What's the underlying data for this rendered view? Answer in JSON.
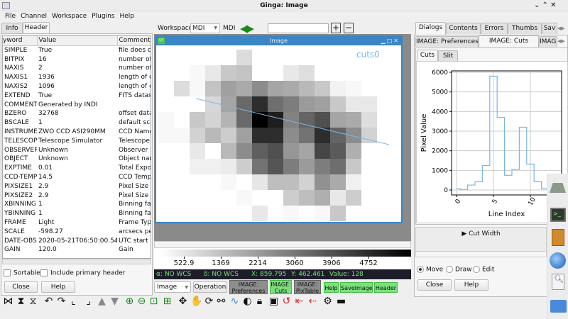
{
  "window": {
    "title": "Ginga: Image"
  },
  "menu": [
    "File",
    "Channel",
    "Workspace",
    "Plugins",
    "Help"
  ],
  "left": {
    "tabs": [
      "Info",
      "Header"
    ],
    "active_tab": "Header",
    "columns": [
      "Keyword",
      "Value",
      "Comment"
    ],
    "column_visible": [
      "yword",
      "Value",
      "Comment"
    ],
    "rows": [
      [
        "SIMPLE",
        "True",
        "file does co"
      ],
      [
        "BITPIX",
        "16",
        "number of"
      ],
      [
        "NAXIS",
        "2",
        "number of"
      ],
      [
        "NAXIS1",
        "1936",
        "length of d"
      ],
      [
        "NAXIS2",
        "1096",
        "length of d"
      ],
      [
        "EXTEND",
        "True",
        "FITS datase"
      ],
      [
        "COMMENT",
        "Generated by INDI",
        ""
      ],
      [
        "BZERO",
        "32768",
        "offset data"
      ],
      [
        "BSCALE",
        "1",
        "default sca"
      ],
      [
        "INSTRUME",
        "ZWO CCD ASI290MM",
        "CCD Name"
      ],
      [
        "TELESCOP",
        "Telescope Simulator",
        "Telescope"
      ],
      [
        "OBSERVER",
        "Unknown",
        "Observer n"
      ],
      [
        "OBJECT",
        "Unknown",
        "Object nam"
      ],
      [
        "EXPTIME",
        "0.01",
        "Total Expos"
      ],
      [
        "CCD-TEMP",
        "14.5",
        "CCD Temp"
      ],
      [
        "PIXSIZE1",
        "2.9",
        "Pixel Size 1"
      ],
      [
        "PIXSIZE2",
        "2.9",
        "Pixel Size 2"
      ],
      [
        "XBINNING",
        "1",
        "Binning fac"
      ],
      [
        "YBINNING",
        "1",
        "Binning fac"
      ],
      [
        "FRAME",
        "Light",
        "Frame Type"
      ],
      [
        "SCALE",
        "-598.27",
        "arcsecs pe"
      ],
      [
        "DATE-OBS",
        "2020-05-21T06:50:00.544Z",
        "UTC start d"
      ],
      [
        "GAIN",
        "120.0",
        "Gain"
      ]
    ],
    "sortable_label": "Sortable",
    "sortable": false,
    "primary_label": "Include primary header",
    "primary": false,
    "close": "Close",
    "help": "Help"
  },
  "workspace": {
    "label": "Workspace",
    "value": "MDI",
    "mode": "MDI",
    "input": ""
  },
  "viewer": {
    "title": "Image",
    "cuts_label": "cuts0",
    "line_color": "#7ab8e8",
    "pixels": [
      [
        255,
        255,
        255,
        255,
        255,
        220,
        255,
        255,
        255,
        255,
        255,
        255,
        255,
        255,
        255
      ],
      [
        255,
        255,
        248,
        232,
        200,
        195,
        255,
        255,
        232,
        222,
        255,
        255,
        255,
        255,
        255
      ],
      [
        255,
        220,
        248,
        195,
        160,
        170,
        140,
        165,
        170,
        185,
        200,
        242,
        248,
        255,
        255
      ],
      [
        255,
        255,
        255,
        215,
        165,
        105,
        45,
        110,
        125,
        155,
        160,
        200,
        232,
        232,
        255
      ],
      [
        248,
        255,
        200,
        212,
        180,
        105,
        0,
        30,
        130,
        100,
        80,
        165,
        170,
        222,
        255
      ],
      [
        248,
        248,
        210,
        185,
        205,
        160,
        45,
        45,
        140,
        115,
        45,
        100,
        140,
        210,
        255
      ],
      [
        255,
        255,
        232,
        255,
        185,
        140,
        95,
        80,
        150,
        165,
        70,
        90,
        175,
        255,
        255
      ],
      [
        255,
        255,
        240,
        240,
        235,
        205,
        115,
        85,
        125,
        155,
        125,
        110,
        200,
        255,
        255
      ],
      [
        255,
        255,
        255,
        255,
        248,
        255,
        230,
        190,
        190,
        210,
        145,
        170,
        240,
        255,
        255
      ],
      [
        255,
        255,
        255,
        255,
        255,
        248,
        255,
        255,
        205,
        190,
        175,
        232,
        205,
        255,
        255
      ],
      [
        255,
        255,
        255,
        255,
        255,
        255,
        232,
        255,
        248,
        255,
        248,
        200,
        255,
        255,
        255
      ]
    ],
    "colorbar_ticks": [
      "522.9",
      "1369",
      "2214",
      "3060",
      "3906",
      "4752"
    ]
  },
  "status": {
    "ra": "α: NO WCS",
    "dec": "δ: NO WCS",
    "x": "X: 859.795",
    "y": "Y: 462.461",
    "value": "Value: 128"
  },
  "bottom": {
    "mode_select": "Image",
    "operation": "Operation",
    "plugins": [
      {
        "l1": "IMAGE:",
        "l2": "Preferences",
        "active": false
      },
      {
        "l1": "IMAGE:",
        "l2": "Cuts",
        "active": true
      },
      {
        "l1": "IMAGE:",
        "l2": "PixTable",
        "active": false
      }
    ],
    "help": "Help",
    "save": "SaveImage",
    "header": "Header"
  },
  "right": {
    "tabs": [
      "Dialogs",
      "Contents",
      "Errors",
      "Thumbs",
      "Sav"
    ],
    "active_tab": "Dialogs",
    "subtabs": [
      "IMAGE: Preferences",
      "IMAGE: Cuts",
      "IMAGE: P"
    ],
    "active_subtab": "IMAGE: Cuts",
    "cuttabs": [
      "Cuts",
      "Slit"
    ],
    "cut_width": "▶ Cut Width",
    "radios": [
      "Move",
      "Draw",
      "Edit"
    ],
    "selected_radio": "Move",
    "close": "Close",
    "help": "Help"
  },
  "chart_data": {
    "type": "line",
    "step": true,
    "xlabel": "Line Index",
    "ylabel": "Pixel Value",
    "x": [
      0,
      1,
      2,
      3,
      4,
      5,
      6,
      7,
      8,
      9,
      10,
      11,
      12,
      13
    ],
    "values": [
      60,
      20,
      250,
      420,
      1250,
      5800,
      3700,
      750,
      1050,
      3200,
      1320,
      420,
      60,
      100
    ],
    "xticks": [
      "0",
      "5",
      "10"
    ],
    "yticks": [
      "0",
      "1000",
      "2000",
      "3000",
      "4000",
      "5000",
      "6000"
    ],
    "ylim": [
      -250,
      6100
    ],
    "xlim": [
      -1,
      14
    ],
    "grid": true,
    "color": "#7ab8e8"
  }
}
